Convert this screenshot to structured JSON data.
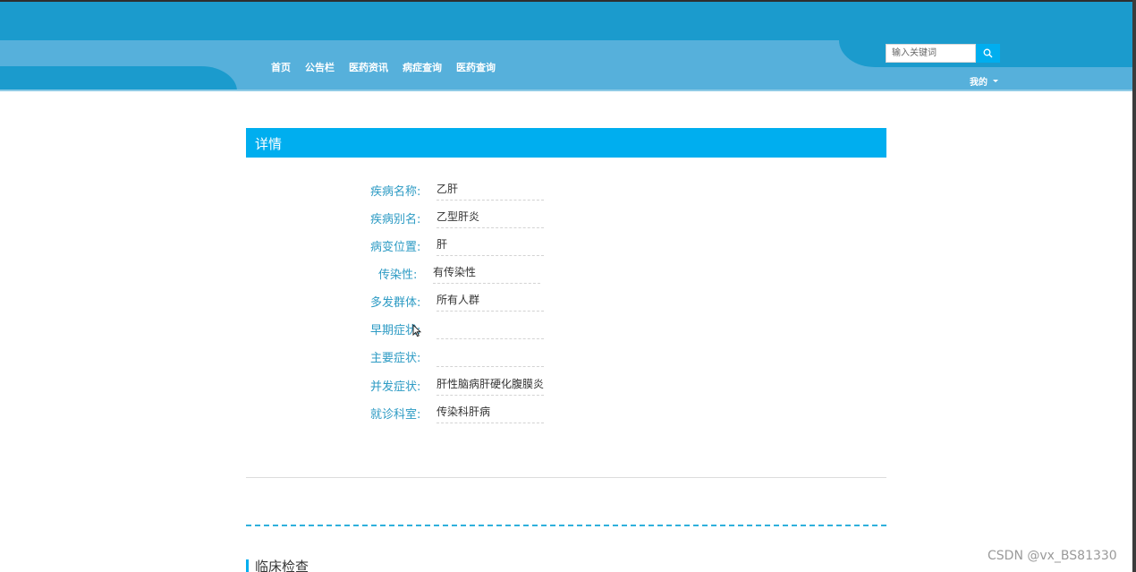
{
  "header": {
    "nav": [
      "首页",
      "公告栏",
      "医药资讯",
      "病症查询",
      "医药查询"
    ],
    "search": {
      "placeholder": "输入关键词"
    },
    "user_menu_label": "我的"
  },
  "detail": {
    "title": "详情",
    "fields": [
      {
        "label": "疾病名称:",
        "value": "乙肝"
      },
      {
        "label": "疾病别名:",
        "value": "乙型肝炎"
      },
      {
        "label": "病变位置:",
        "value": "肝"
      },
      {
        "label": "传染性:",
        "value": "有传染性"
      },
      {
        "label": "多发群体:",
        "value": "所有人群"
      },
      {
        "label": "早期症状:",
        "value": ""
      },
      {
        "label": "主要症状:",
        "value": ""
      },
      {
        "label": "并发症状:",
        "value": "肝性脑病肝硬化腹膜炎"
      },
      {
        "label": "就诊科室:",
        "value": "传染科肝病"
      }
    ]
  },
  "section": {
    "heading": "临床检查"
  },
  "watermark": "CSDN @vx_BS81330",
  "colors": {
    "primary": "#00aeef",
    "header": "#1b9bcd",
    "header_band": "#56b0db",
    "label": "#2d9bc4"
  }
}
